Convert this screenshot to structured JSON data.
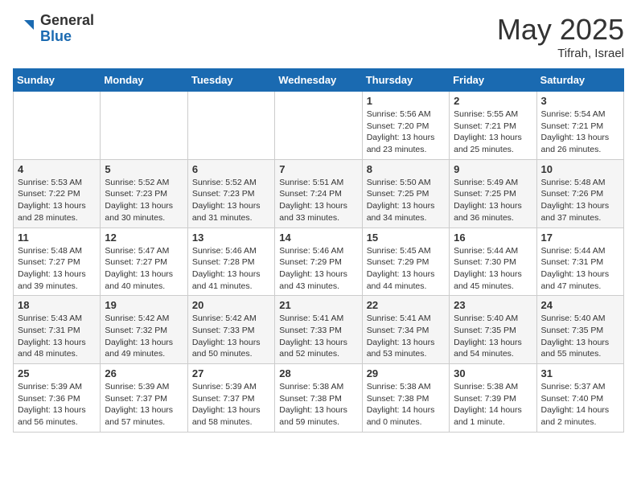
{
  "header": {
    "logo_general": "General",
    "logo_blue": "Blue",
    "month_title": "May 2025",
    "location": "Tifrah, Israel"
  },
  "days_of_week": [
    "Sunday",
    "Monday",
    "Tuesday",
    "Wednesday",
    "Thursday",
    "Friday",
    "Saturday"
  ],
  "weeks": [
    [
      {
        "day": "",
        "info": ""
      },
      {
        "day": "",
        "info": ""
      },
      {
        "day": "",
        "info": ""
      },
      {
        "day": "",
        "info": ""
      },
      {
        "day": "1",
        "info": "Sunrise: 5:56 AM\nSunset: 7:20 PM\nDaylight: 13 hours\nand 23 minutes."
      },
      {
        "day": "2",
        "info": "Sunrise: 5:55 AM\nSunset: 7:21 PM\nDaylight: 13 hours\nand 25 minutes."
      },
      {
        "day": "3",
        "info": "Sunrise: 5:54 AM\nSunset: 7:21 PM\nDaylight: 13 hours\nand 26 minutes."
      }
    ],
    [
      {
        "day": "4",
        "info": "Sunrise: 5:53 AM\nSunset: 7:22 PM\nDaylight: 13 hours\nand 28 minutes."
      },
      {
        "day": "5",
        "info": "Sunrise: 5:52 AM\nSunset: 7:23 PM\nDaylight: 13 hours\nand 30 minutes."
      },
      {
        "day": "6",
        "info": "Sunrise: 5:52 AM\nSunset: 7:23 PM\nDaylight: 13 hours\nand 31 minutes."
      },
      {
        "day": "7",
        "info": "Sunrise: 5:51 AM\nSunset: 7:24 PM\nDaylight: 13 hours\nand 33 minutes."
      },
      {
        "day": "8",
        "info": "Sunrise: 5:50 AM\nSunset: 7:25 PM\nDaylight: 13 hours\nand 34 minutes."
      },
      {
        "day": "9",
        "info": "Sunrise: 5:49 AM\nSunset: 7:25 PM\nDaylight: 13 hours\nand 36 minutes."
      },
      {
        "day": "10",
        "info": "Sunrise: 5:48 AM\nSunset: 7:26 PM\nDaylight: 13 hours\nand 37 minutes."
      }
    ],
    [
      {
        "day": "11",
        "info": "Sunrise: 5:48 AM\nSunset: 7:27 PM\nDaylight: 13 hours\nand 39 minutes."
      },
      {
        "day": "12",
        "info": "Sunrise: 5:47 AM\nSunset: 7:27 PM\nDaylight: 13 hours\nand 40 minutes."
      },
      {
        "day": "13",
        "info": "Sunrise: 5:46 AM\nSunset: 7:28 PM\nDaylight: 13 hours\nand 41 minutes."
      },
      {
        "day": "14",
        "info": "Sunrise: 5:46 AM\nSunset: 7:29 PM\nDaylight: 13 hours\nand 43 minutes."
      },
      {
        "day": "15",
        "info": "Sunrise: 5:45 AM\nSunset: 7:29 PM\nDaylight: 13 hours\nand 44 minutes."
      },
      {
        "day": "16",
        "info": "Sunrise: 5:44 AM\nSunset: 7:30 PM\nDaylight: 13 hours\nand 45 minutes."
      },
      {
        "day": "17",
        "info": "Sunrise: 5:44 AM\nSunset: 7:31 PM\nDaylight: 13 hours\nand 47 minutes."
      }
    ],
    [
      {
        "day": "18",
        "info": "Sunrise: 5:43 AM\nSunset: 7:31 PM\nDaylight: 13 hours\nand 48 minutes."
      },
      {
        "day": "19",
        "info": "Sunrise: 5:42 AM\nSunset: 7:32 PM\nDaylight: 13 hours\nand 49 minutes."
      },
      {
        "day": "20",
        "info": "Sunrise: 5:42 AM\nSunset: 7:33 PM\nDaylight: 13 hours\nand 50 minutes."
      },
      {
        "day": "21",
        "info": "Sunrise: 5:41 AM\nSunset: 7:33 PM\nDaylight: 13 hours\nand 52 minutes."
      },
      {
        "day": "22",
        "info": "Sunrise: 5:41 AM\nSunset: 7:34 PM\nDaylight: 13 hours\nand 53 minutes."
      },
      {
        "day": "23",
        "info": "Sunrise: 5:40 AM\nSunset: 7:35 PM\nDaylight: 13 hours\nand 54 minutes."
      },
      {
        "day": "24",
        "info": "Sunrise: 5:40 AM\nSunset: 7:35 PM\nDaylight: 13 hours\nand 55 minutes."
      }
    ],
    [
      {
        "day": "25",
        "info": "Sunrise: 5:39 AM\nSunset: 7:36 PM\nDaylight: 13 hours\nand 56 minutes."
      },
      {
        "day": "26",
        "info": "Sunrise: 5:39 AM\nSunset: 7:37 PM\nDaylight: 13 hours\nand 57 minutes."
      },
      {
        "day": "27",
        "info": "Sunrise: 5:39 AM\nSunset: 7:37 PM\nDaylight: 13 hours\nand 58 minutes."
      },
      {
        "day": "28",
        "info": "Sunrise: 5:38 AM\nSunset: 7:38 PM\nDaylight: 13 hours\nand 59 minutes."
      },
      {
        "day": "29",
        "info": "Sunrise: 5:38 AM\nSunset: 7:38 PM\nDaylight: 14 hours\nand 0 minutes."
      },
      {
        "day": "30",
        "info": "Sunrise: 5:38 AM\nSunset: 7:39 PM\nDaylight: 14 hours\nand 1 minute."
      },
      {
        "day": "31",
        "info": "Sunrise: 5:37 AM\nSunset: 7:40 PM\nDaylight: 14 hours\nand 2 minutes."
      }
    ]
  ]
}
